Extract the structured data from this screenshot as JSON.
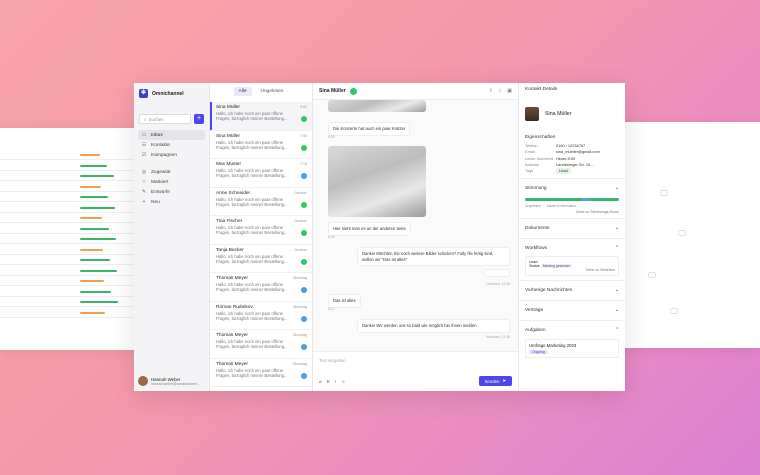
{
  "app": {
    "name": "Omnichannel"
  },
  "search": {
    "placeholder": "Suchen"
  },
  "nav": {
    "items": [
      {
        "label": "Inbox",
        "icon": "inbox-icon"
      },
      {
        "label": "Kontakte",
        "icon": "contacts-icon"
      },
      {
        "label": "Kampagnen",
        "icon": "campaign-icon"
      }
    ],
    "items2": [
      {
        "label": "Zugewiät",
        "icon": "assigned-icon"
      },
      {
        "label": "Markiert",
        "icon": "star-icon"
      },
      {
        "label": "Entwürfe",
        "icon": "draft-icon"
      },
      {
        "label": "Neu",
        "icon": "plus-icon"
      }
    ]
  },
  "user": {
    "name": "Hannah Weber",
    "email": "hannah.weber@omnichannel..."
  },
  "tabs": {
    "all": "Alle",
    "unread": "Ungelesen"
  },
  "conversations": [
    {
      "name": "Sina Müller",
      "time": "9:02",
      "preview": "Hallo, ich habe noch ein paar offene Fragen, bezüglich meiner Bestellung...",
      "channel": "whatsapp"
    },
    {
      "name": "Sina Müller",
      "time": "7:56",
      "preview": "Hallo, ich habe noch ein paar offene Fragen, bezüglich meiner Bestellung...",
      "channel": "whatsapp"
    },
    {
      "name": "Max Muster",
      "time": "7:16",
      "preview": "Hallo, ich habe noch ein paar offene Fragen, bezüglich meiner Bestellung...",
      "channel": "telegram"
    },
    {
      "name": "Anne Schneider",
      "time": "Gestern",
      "preview": "Hallo, ich habe noch ein paar offene Fragen, bezüglich meiner Bestellung...",
      "channel": "whatsapp"
    },
    {
      "name": "Tina Fischer",
      "time": "Gestern",
      "preview": "Hallo, ich habe noch ein paar offene Fragen, bezüglich meiner Bestellung...",
      "channel": "whatsapp"
    },
    {
      "name": "Tanja Becker",
      "time": "Gestern",
      "preview": "Hallo, ich habe noch ein paar offene Fragen, bezüglich meiner Bestellung...",
      "channel": "whatsapp"
    },
    {
      "name": "Thomas Meyer",
      "time": "Dienstag",
      "preview": "Hallo, ich habe noch ein paar offene Fragen, bezüglich meiner Bestellung...",
      "channel": "telegram"
    },
    {
      "name": "Roman Rudnikov",
      "time": "Dienstag",
      "preview": "Hallo, ich habe noch ein paar offene Fragen, bezüglich meiner Bestellung...",
      "channel": "telegram"
    },
    {
      "name": "Thomas Meyer",
      "time": "Dienstag",
      "preview": "Hallo, ich habe noch ein paar offene Fragen, bezüglich meiner Bestellung...",
      "channel": "telegram"
    },
    {
      "name": "Thomas Meyer",
      "time": "Dienstag",
      "preview": "Hallo, ich habe noch ein paar offene Fragen, bezüglich meiner Bestellung...",
      "channel": "telegram"
    }
  ],
  "chat": {
    "title": "Sina Müller",
    "messages": [
      {
        "text": "Die Konzerte hat auch ein paar Kratzer",
        "meta": "8:05"
      },
      {
        "text": "Hier sieht man es an der anderen Seite",
        "meta": "8:05"
      },
      {
        "text": "Danke! Möchten Sie noch weitere Bilder schicken? Fully file fertig sind, wollen wir \"Das ist alles\"",
        "meta": ""
      },
      {
        "text": "Das ist alles",
        "meta": "8:12"
      },
      {
        "text": "Danke! Wir werden uns so bald wie möglich bei Ihnen melden.",
        "meta": "Assistant, 11:38"
      }
    ],
    "meta_sent": "Gesehen, 11:38",
    "compose_placeholder": "Text eingeben",
    "send": "Senden"
  },
  "details": {
    "header": "Kontakt Details",
    "name": "Sina Müller",
    "props_title": "Eigenschaften",
    "props": [
      {
        "k": "Telefon",
        "v": "0160 / 12234767"
      },
      {
        "k": "Email",
        "v": "sina_mueller@gmail.com"
      },
      {
        "k": "Letzte Nachricht",
        "v": "Heute 8:53"
      },
      {
        "k": "Adresse",
        "v": "Landsberger Str. 15,..."
      },
      {
        "k": "Tags",
        "v": "Lead"
      }
    ],
    "mood": "Stimmung",
    "mood_legend": [
      "Ungelesen",
      "Letzte Konversation"
    ],
    "mood_link": "Gehe zu Stimmungs-Score",
    "documents": "Dokumente",
    "workflows": "Workflows",
    "wf_label": "Lead",
    "wf_status": "Meeting gesendet",
    "wf_link": "Gehe zu Workflow",
    "prev": "Vorherige Nachrichten",
    "contracts": "Verträge",
    "tasks": "Aufgaben",
    "campaign": "Umfrage Marketing 2023",
    "campaign_status": "Ongoing"
  },
  "colors": {
    "accent": "#4f46e5",
    "whatsapp": "#35c36b",
    "telegram": "#4a9ee0",
    "lead": "#2d8a43"
  }
}
